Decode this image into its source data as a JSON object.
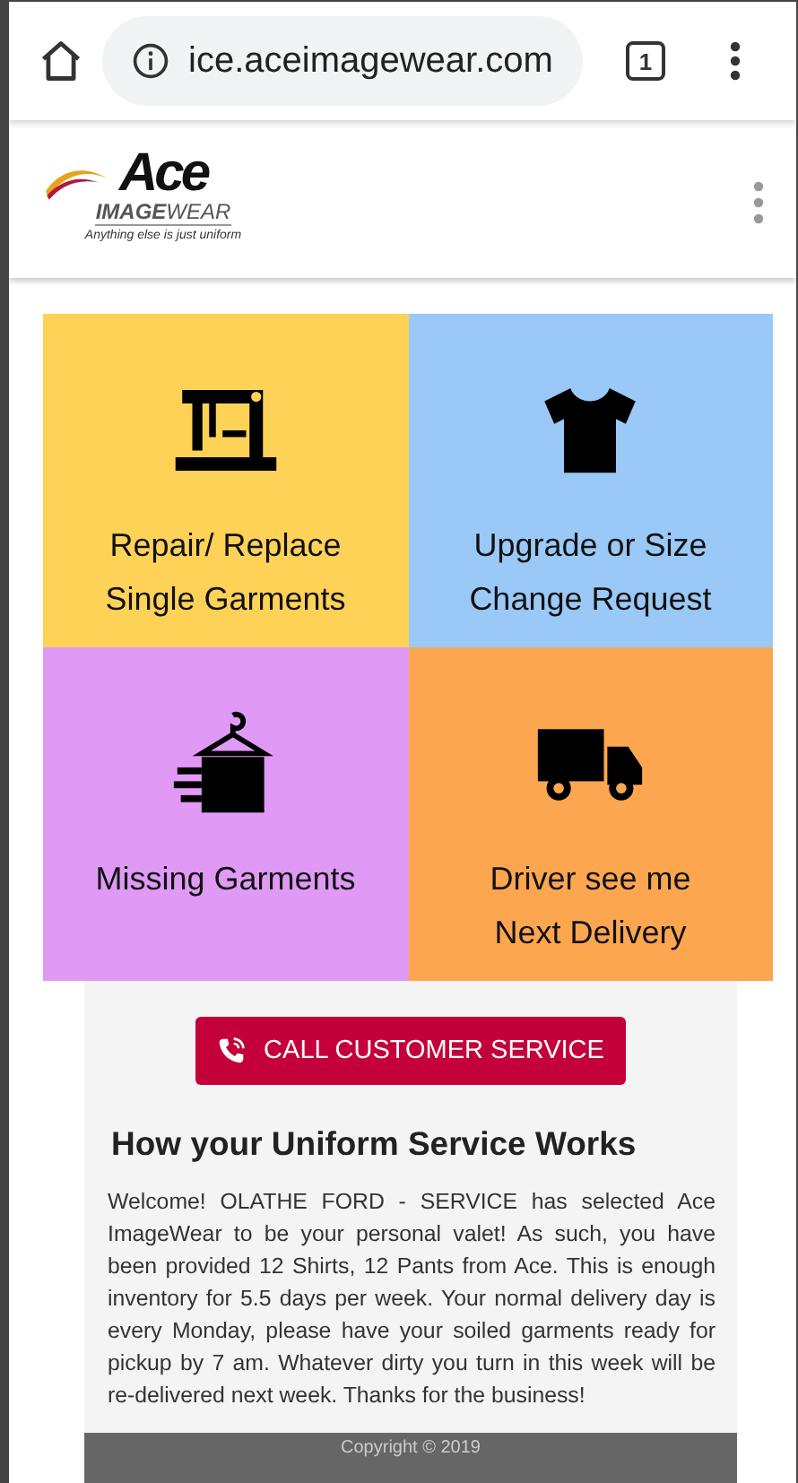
{
  "browser": {
    "url": "ice.aceimagewear.com",
    "tab_count": "1"
  },
  "logo": {
    "name": "Ace",
    "brand": "**IMAGE**WEAR",
    "tagline": "Anything else is just uniform"
  },
  "tiles": [
    {
      "kind": "sewing",
      "label": "Repair/ Replace Single Garments",
      "color": "#fdd257"
    },
    {
      "kind": "shirt",
      "label": "Upgrade or Size Change Request",
      "color": "#9ac9f8"
    },
    {
      "kind": "hanger",
      "label": "Missing Garments",
      "color": "#e09af6"
    },
    {
      "kind": "truck",
      "label": "Driver see me Next Delivery",
      "color": "#fca64f"
    }
  ],
  "call_button": "CALL CUSTOMER SERVICE",
  "section": {
    "title": "How your Uniform Service Works",
    "body": "Welcome!  OLATHE FORD - SERVICE has selected Ace ImageWear to be your personal valet!  As such, you have been provided 12 Shirts, 12 Pants from Ace.  This is enough inventory for 5.5 days per week.  Your normal delivery day is every Monday, please have your soiled garments ready for pickup by 7 am.  Whatever dirty you turn in this week will be re-delivered next week.  Thanks for the business!"
  },
  "footer": "Copyright © 2019"
}
